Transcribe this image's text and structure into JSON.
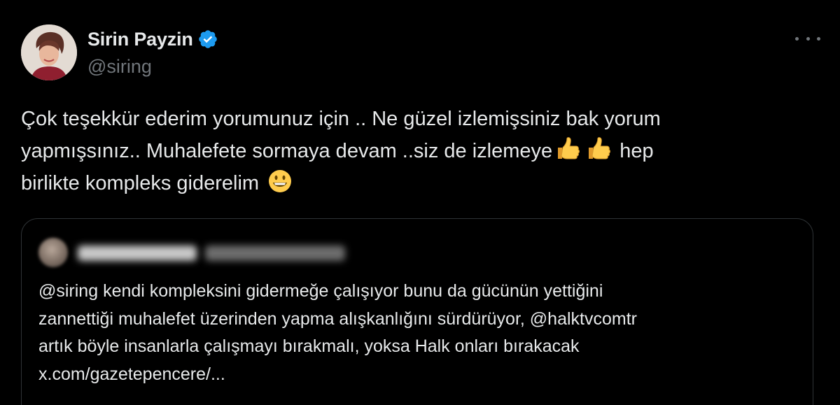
{
  "tweet": {
    "author": {
      "display_name": "Sirin Payzin",
      "handle": "@siring",
      "verified": true,
      "avatar_icon": "profile-photo"
    },
    "more_icon": "ellipsis-icon",
    "text": {
      "line1": "Çok teşekkür ederim yorumunuz için .. Ne güzel izlemişsiniz bak yorum",
      "line2_before_emoji": "yapmışsınız.. Muhalefete sormaya devam ..siz de izlemeye",
      "line2_after_emoji": "hep",
      "line3": "birlikte kompleks giderelim",
      "emojis": [
        "thumbs-up",
        "thumbs-up",
        "grinning-face"
      ]
    }
  },
  "quoted_tweet": {
    "author_blurred": true,
    "text": {
      "line1": "@siring kendi kompleksini gidermeğe çalışıyor bunu da gücünün yettiğini",
      "line2": "zannettiği muhalefet üzerinden yapma alışkanlığını sürdürüyor, @halktvcomtr",
      "line3": "artık böyle insanlarla çalışmayı bırakmalı, yoksa Halk onları bırakacak",
      "line4": "x.com/gazetepencere/..."
    }
  },
  "colors": {
    "background": "#000000",
    "primary_text": "#e7e9ea",
    "secondary_text": "#71767b",
    "border": "#2f3336",
    "verified_blue": "#1d9bf0"
  }
}
